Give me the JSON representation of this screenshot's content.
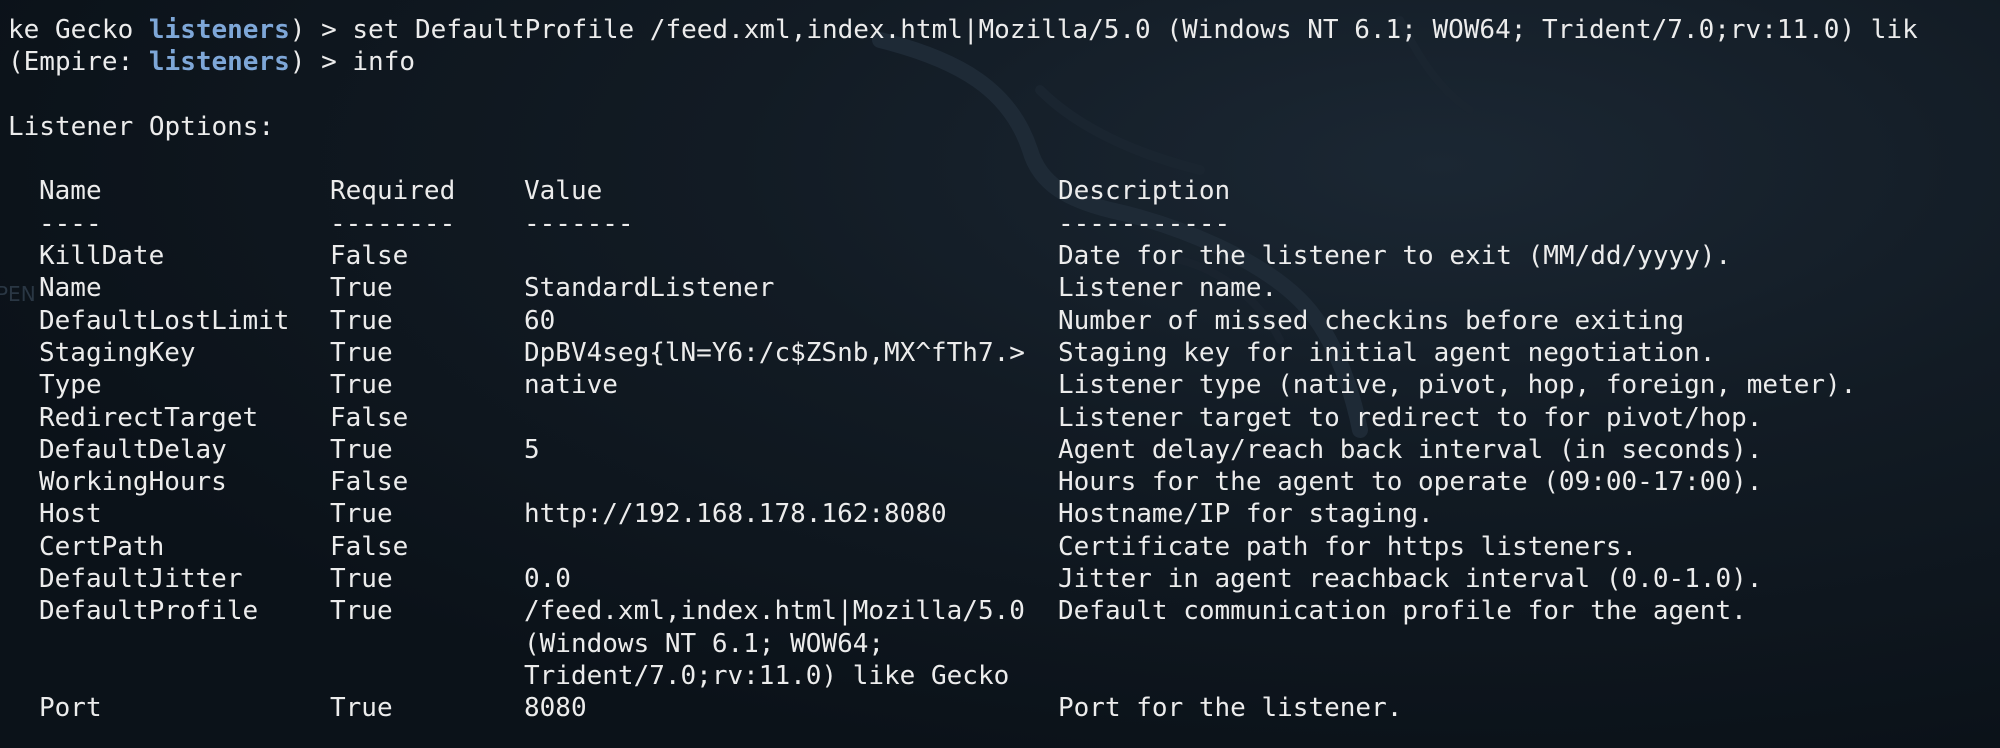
{
  "terminal": {
    "prompt_prefix_first": "ke Gecko ",
    "prompt_kw": "listeners",
    "cmd_first": ") > set DefaultProfile /feed.xml,index.html|Mozilla/5.0 (Windows NT 6.1; WOW64; Trident/7.0;rv:11.0) lik",
    "prompt_prefix_second": "(Empire: ",
    "cmd_second": ") > info",
    "section_title": "Listener Options:",
    "side_tag": "PEN"
  },
  "table": {
    "headers": {
      "name": "Name",
      "required": "Required",
      "value": "Value",
      "description": "Description"
    },
    "separators": {
      "name": "----",
      "required": "--------",
      "value": "-------",
      "description": "-----------"
    },
    "rows": [
      {
        "name": "KillDate",
        "required": "False",
        "value": "",
        "description": "Date for the listener to exit (MM/dd/yyyy)."
      },
      {
        "name": "Name",
        "required": "True",
        "value": "StandardListener",
        "description": "Listener name."
      },
      {
        "name": "DefaultLostLimit",
        "required": "True",
        "value": "60",
        "description": "Number of missed checkins before exiting"
      },
      {
        "name": "StagingKey",
        "required": "True",
        "value": "DpBV4seg{lN=Y6:/c$ZSnb,MX^fTh7.>",
        "description": "Staging key for initial agent negotiation."
      },
      {
        "name": "Type",
        "required": "True",
        "value": "native",
        "description": "Listener type (native, pivot, hop, foreign, meter)."
      },
      {
        "name": "RedirectTarget",
        "required": "False",
        "value": "",
        "description": "Listener target to redirect to for pivot/hop."
      },
      {
        "name": "DefaultDelay",
        "required": "True",
        "value": "5",
        "description": "Agent delay/reach back interval (in seconds)."
      },
      {
        "name": "WorkingHours",
        "required": "False",
        "value": "",
        "description": "Hours for the agent to operate (09:00-17:00)."
      },
      {
        "name": "Host",
        "required": "True",
        "value": "http://192.168.178.162:8080",
        "description": "Hostname/IP for staging."
      },
      {
        "name": "CertPath",
        "required": "False",
        "value": "",
        "description": "Certificate path for https listeners."
      },
      {
        "name": "DefaultJitter",
        "required": "True",
        "value": "0.0",
        "description": "Jitter in agent reachback interval (0.0-1.0)."
      },
      {
        "name": "DefaultProfile",
        "required": "True",
        "value": "/feed.xml,index.html|Mozilla/5.0\n(Windows NT 6.1; WOW64;\nTrident/7.0;rv:11.0) like Gecko",
        "description": "Default communication profile for the agent."
      },
      {
        "name": "Port",
        "required": "True",
        "value": "8080",
        "description": "Port for the listener."
      }
    ]
  },
  "colors": {
    "background": "#0b1219",
    "text": "#ececec",
    "prompt_keyword": "#7ea7d8"
  }
}
